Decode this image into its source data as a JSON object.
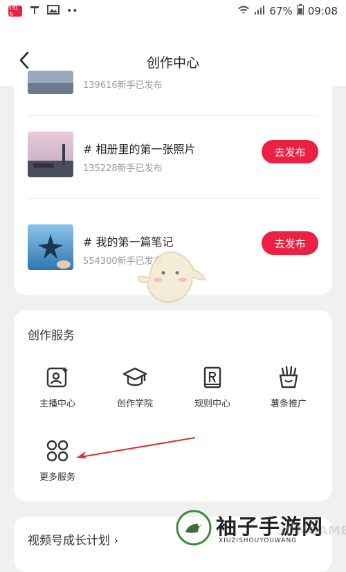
{
  "status_bar": {
    "battery": "67%",
    "time": "09:08",
    "app_badge": "小红书"
  },
  "header": {
    "title": "创作中心"
  },
  "tasks": [
    {
      "title": "",
      "sub": "139616新手已发布"
    },
    {
      "title": "# 相册里的第一张照片",
      "sub": "135228新手已发布",
      "button": "去发布"
    },
    {
      "title": "# 我的第一篇笔记",
      "sub": "554300新手已发布",
      "button": "去发布"
    }
  ],
  "services": {
    "title": "创作服务",
    "items": [
      {
        "label": "主播中心",
        "icon": "anchor-center-icon"
      },
      {
        "label": "创作学院",
        "icon": "graduation-cap-icon"
      },
      {
        "label": "规则中心",
        "icon": "rule-book-icon"
      },
      {
        "label": "薯条推广",
        "icon": "fries-icon"
      },
      {
        "label": "更多服务",
        "icon": "grid-more-icon"
      }
    ]
  },
  "growth": {
    "label": "视频号成长计划 ›"
  },
  "watermark": {
    "text": "袖子手游网",
    "sub": "XIUZISHOUYOUWANG",
    "faded": "3DMGAME"
  },
  "colors": {
    "accent": "#ea2142",
    "arrow": "#e02a2a"
  }
}
